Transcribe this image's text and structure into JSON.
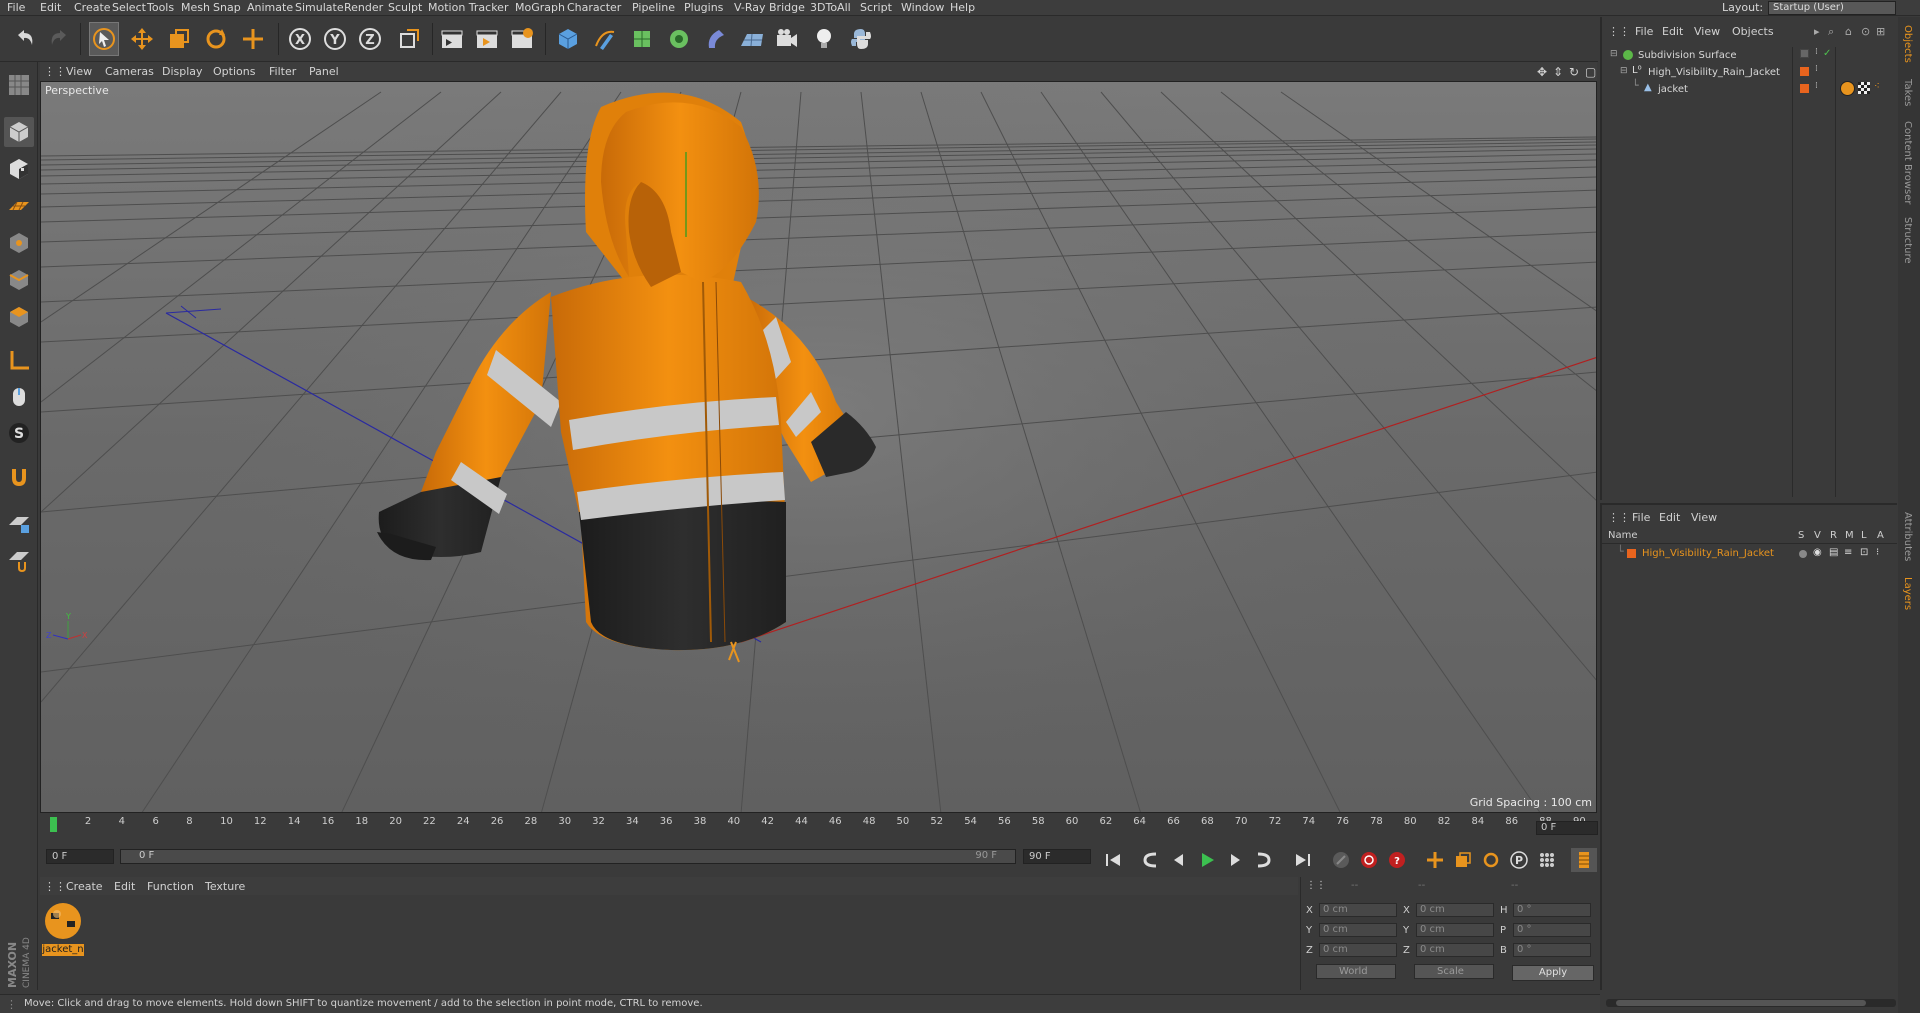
{
  "menubar": {
    "items": [
      "File",
      "Edit",
      "Create",
      "Select",
      "Tools",
      "Mesh",
      "Snap",
      "Animate",
      "Simulate",
      "Render",
      "Sculpt",
      "Motion Tracker",
      "MoGraph",
      "Character",
      "Pipeline",
      "Plugins",
      "V-Ray Bridge",
      "3DToAll",
      "Script",
      "Window",
      "Help"
    ],
    "layout_label": "Layout:",
    "layout_value": "Startup (User)"
  },
  "viewport": {
    "menu": [
      "View",
      "Cameras",
      "Display",
      "Options",
      "Filter",
      "Panel"
    ],
    "label": "Perspective",
    "grid_spacing": "Grid Spacing : 100 cm"
  },
  "timeline": {
    "ticks": [
      "0",
      "2",
      "4",
      "6",
      "8",
      "10",
      "12",
      "14",
      "16",
      "18",
      "20",
      "22",
      "24",
      "26",
      "28",
      "30",
      "32",
      "34",
      "36",
      "38",
      "40",
      "42",
      "44",
      "46",
      "48",
      "50",
      "52",
      "54",
      "56",
      "58",
      "60",
      "62",
      "64",
      "66",
      "68",
      "70",
      "72",
      "74",
      "76",
      "78",
      "80",
      "82",
      "84",
      "86",
      "88",
      "90"
    ],
    "current_frame": "0 F",
    "start_field": "0 F",
    "range_start": "0 F",
    "range_end": "90 F",
    "end_field": "90 F"
  },
  "material_manager": {
    "menu": [
      "Create",
      "Edit",
      "Function",
      "Texture"
    ],
    "materials": [
      {
        "name": "jacket_n"
      }
    ]
  },
  "coordinates": {
    "header": [
      "--",
      "--",
      "--"
    ],
    "rows": [
      {
        "l1": "X",
        "v1": "0 cm",
        "l2": "X",
        "v2": "0 cm",
        "l3": "H",
        "v3": "0 °"
      },
      {
        "l1": "Y",
        "v1": "0 cm",
        "l2": "Y",
        "v2": "0 cm",
        "l3": "P",
        "v3": "0 °"
      },
      {
        "l1": "Z",
        "v1": "0 cm",
        "l2": "Z",
        "v2": "0 cm",
        "l3": "B",
        "v3": "0 °"
      }
    ],
    "space": "World",
    "mode": "Scale",
    "apply_label": "Apply"
  },
  "object_manager": {
    "menu": [
      "File",
      "Edit",
      "View",
      "Objects"
    ],
    "objects": [
      {
        "name": "Subdivision Surface",
        "color": "#9fd36b"
      },
      {
        "name": "High_Visibility_Rain_Jacket",
        "color": "#d8d8d8"
      },
      {
        "name": "jacket",
        "color": "#d8d8d8"
      }
    ]
  },
  "layer_manager": {
    "menu": [
      "File",
      "Edit",
      "View"
    ],
    "columns": [
      "Name",
      "S",
      "V",
      "R",
      "M",
      "L",
      "A"
    ],
    "layers": [
      {
        "name": "High_Visibility_Rain_Jacket",
        "color": "#e8941e"
      }
    ]
  },
  "side_tabs": [
    "Objects",
    "Takes",
    "Content Browser",
    "Structure",
    "Attributes",
    "Layers"
  ],
  "brand": {
    "line1": "MAXON",
    "line2": "CINEMA 4D"
  },
  "status": "Move: Click and drag to move elements. Hold down SHIFT to quantize movement / add to the selection in point mode, CTRL to remove.",
  "colors": {
    "accent": "#e8941e",
    "jacket_orange": "#f08a0c",
    "reflective": "#c8c8c8",
    "dark_fabric": "#2a2a2a",
    "viewport_bg": "#6b6b6b"
  }
}
